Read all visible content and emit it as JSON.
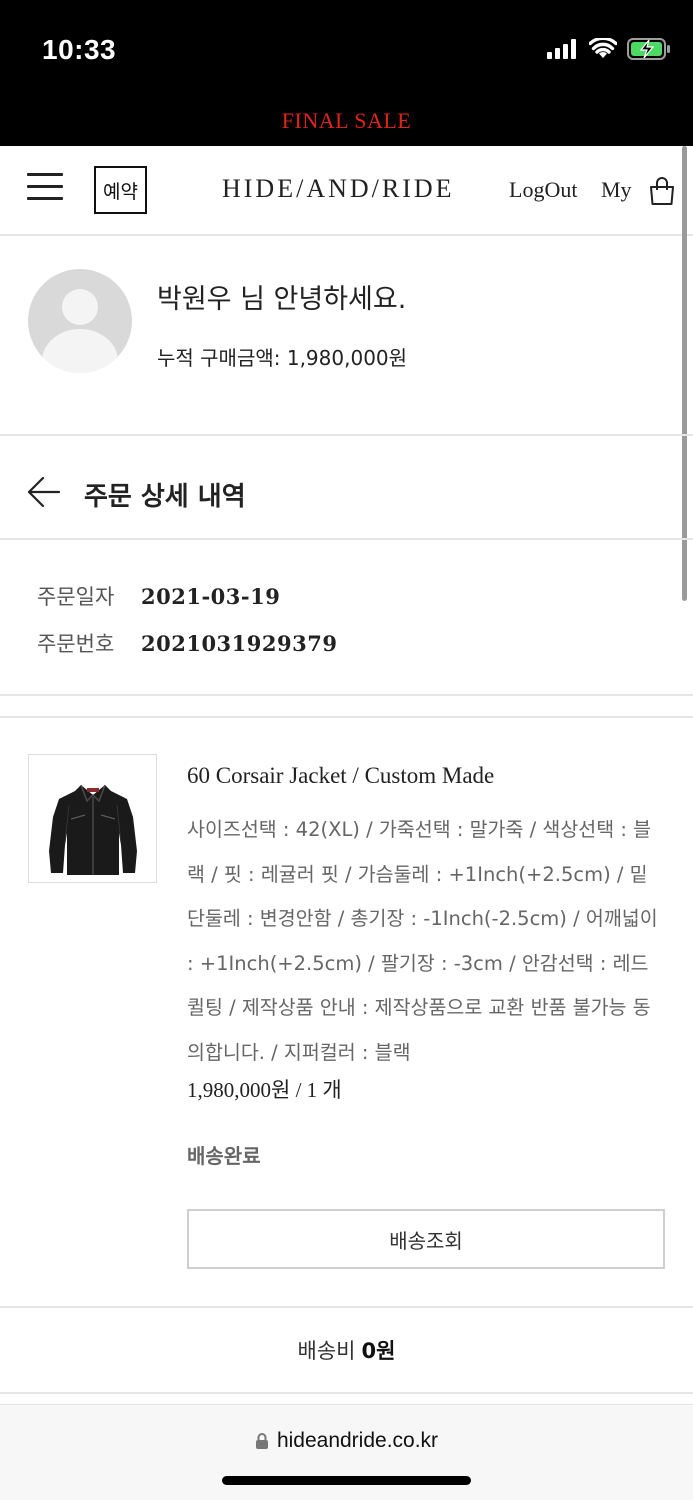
{
  "status_bar": {
    "time": "10:33"
  },
  "banner": {
    "text": "FINAL SALE",
    "color": "#e2231a"
  },
  "header": {
    "reserve_label": "예약",
    "logo": "HIDE/AND/RIDE",
    "logout_label": "LogOut",
    "my_label": "My"
  },
  "profile": {
    "greeting": "박원우 님 안녕하세요.",
    "cumulative_label": "누적 구매금액: 1,980,000원"
  },
  "page": {
    "title": "주문 상세 내역"
  },
  "order": {
    "date_label": "주문일자",
    "date_value": "2021-03-19",
    "number_label": "주문번호",
    "number_value": "2021031929379"
  },
  "product": {
    "name": "60 Corsair Jacket / Custom Made",
    "options": "사이즈선택 : 42(XL) / 가죽선택 : 말가죽 / 색상선택 : 블랙 / 핏 : 레귤러 핏 / 가슴둘레 : +1Inch(+2.5cm) / 밑단둘레 : 변경안함 / 총기장 : -1Inch(-2.5cm) / 어깨넓이 : +1Inch(+2.5cm) / 팔기장 : -3cm / 안감선택 : 레드퀼팅 / 제작상품 안내 : 제작상품으로 교환 반품 불가능 동의합니다. / 지퍼컬러 : 블랙",
    "price_qty": "1,980,000원 / 1 개",
    "status": "배송완료",
    "track_button": "배송조회"
  },
  "shipping": {
    "label": "배송비",
    "value": "0원"
  },
  "browser": {
    "url": "hideandride.co.kr"
  }
}
